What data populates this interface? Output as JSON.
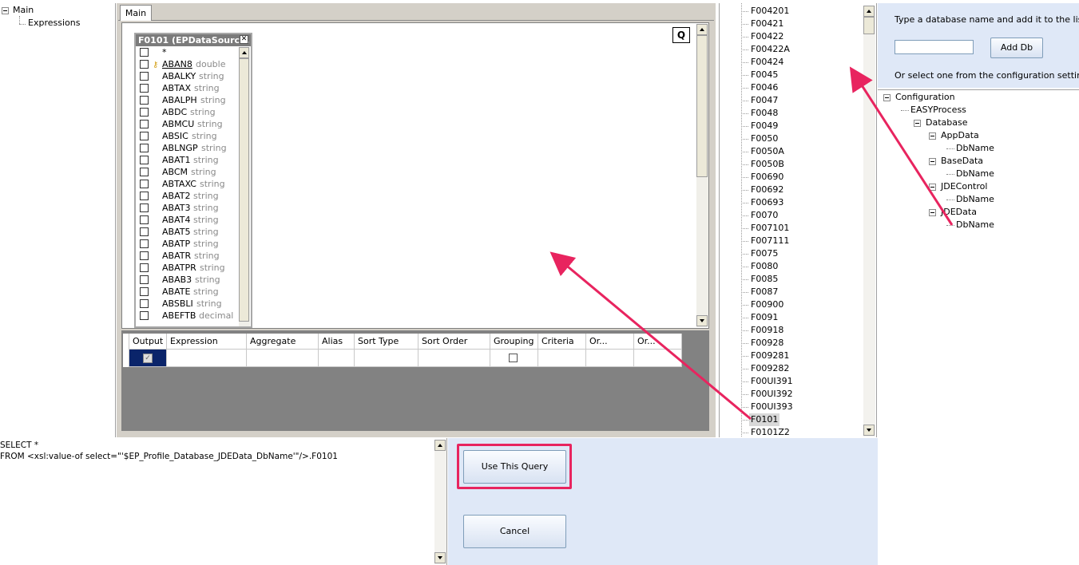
{
  "nav_tree": {
    "items": [
      {
        "label": "Main",
        "level": 0
      },
      {
        "label": "Expressions",
        "level": 1
      }
    ]
  },
  "designer": {
    "tab_label": "Main",
    "q_button_label": "Q",
    "table_box": {
      "title": "F0101 (EPDataSourc...",
      "close_glyph": "✕",
      "columns": [
        {
          "name": "*",
          "type": ""
        },
        {
          "name": "ABAN8",
          "type": "double",
          "key": true
        },
        {
          "name": "ABALKY",
          "type": "string"
        },
        {
          "name": "ABTAX",
          "type": "string"
        },
        {
          "name": "ABALPH",
          "type": "string"
        },
        {
          "name": "ABDC",
          "type": "string"
        },
        {
          "name": "ABMCU",
          "type": "string"
        },
        {
          "name": "ABSIC",
          "type": "string"
        },
        {
          "name": "ABLNGP",
          "type": "string"
        },
        {
          "name": "ABAT1",
          "type": "string"
        },
        {
          "name": "ABCM",
          "type": "string"
        },
        {
          "name": "ABTAXC",
          "type": "string"
        },
        {
          "name": "ABAT2",
          "type": "string"
        },
        {
          "name": "ABAT3",
          "type": "string"
        },
        {
          "name": "ABAT4",
          "type": "string"
        },
        {
          "name": "ABAT5",
          "type": "string"
        },
        {
          "name": "ABATP",
          "type": "string"
        },
        {
          "name": "ABATR",
          "type": "string"
        },
        {
          "name": "ABATPR",
          "type": "string"
        },
        {
          "name": "ABAB3",
          "type": "string"
        },
        {
          "name": "ABATE",
          "type": "string"
        },
        {
          "name": "ABSBLI",
          "type": "string"
        },
        {
          "name": "ABEFTB",
          "type": "decimal"
        }
      ]
    },
    "grid": {
      "headers": [
        "Output",
        "Expression",
        "Aggregate",
        "Alias",
        "Sort Type",
        "Sort Order",
        "Grouping",
        "Criteria",
        "Or...",
        "Or..."
      ]
    }
  },
  "table_list": {
    "items": [
      "F004201",
      "F00421",
      "F00422",
      "F00422A",
      "F00424",
      "F0045",
      "F0046",
      "F0047",
      "F0048",
      "F0049",
      "F0050",
      "F0050A",
      "F0050B",
      "F00690",
      "F00692",
      "F00693",
      "F0070",
      "F007101",
      "F007111",
      "F0075",
      "F0080",
      "F0085",
      "F0087",
      "F00900",
      "F0091",
      "F00918",
      "F00928",
      "F009281",
      "F009282",
      "F00UI391",
      "F00UI392",
      "F00UI393",
      "F0101",
      "F0101Z2"
    ],
    "selected": "F0101"
  },
  "db_panel": {
    "instruction": "Type a database name and add it to the list.",
    "add_button": "Add Db",
    "or_text": "Or select one from the configuration settings:",
    "input_value": ""
  },
  "config_tree": {
    "items": [
      {
        "label": "Configuration",
        "level": 0,
        "expander": true
      },
      {
        "label": "EASYProcess",
        "level": 1,
        "expander": false
      },
      {
        "label": "Database",
        "level": 2,
        "expander": true
      },
      {
        "label": "AppData",
        "level": 3,
        "expander": true
      },
      {
        "label": "DbName",
        "level": 4,
        "expander": false
      },
      {
        "label": "BaseData",
        "level": 3,
        "expander": true
      },
      {
        "label": "DbName",
        "level": 4,
        "expander": false
      },
      {
        "label": "JDEControl",
        "level": 3,
        "expander": true
      },
      {
        "label": "DbName",
        "level": 4,
        "expander": false
      },
      {
        "label": "JDEData",
        "level": 3,
        "expander": true
      },
      {
        "label": "DbName",
        "level": 4,
        "expander": false
      }
    ]
  },
  "sql": {
    "lines": [
      "SELECT *",
      "FROM <xsl:value-of select=\"'$EP_Profile_Database_JDEData_DbName'\"/>.F0101"
    ]
  },
  "actions": {
    "use_query": "Use This Query",
    "cancel": "Cancel"
  },
  "colors": {
    "annotation": "#e8245f",
    "panel_blue": "#dfe8f7",
    "designer_grey": "#d4d0c8",
    "grid_grey": "#828282"
  }
}
